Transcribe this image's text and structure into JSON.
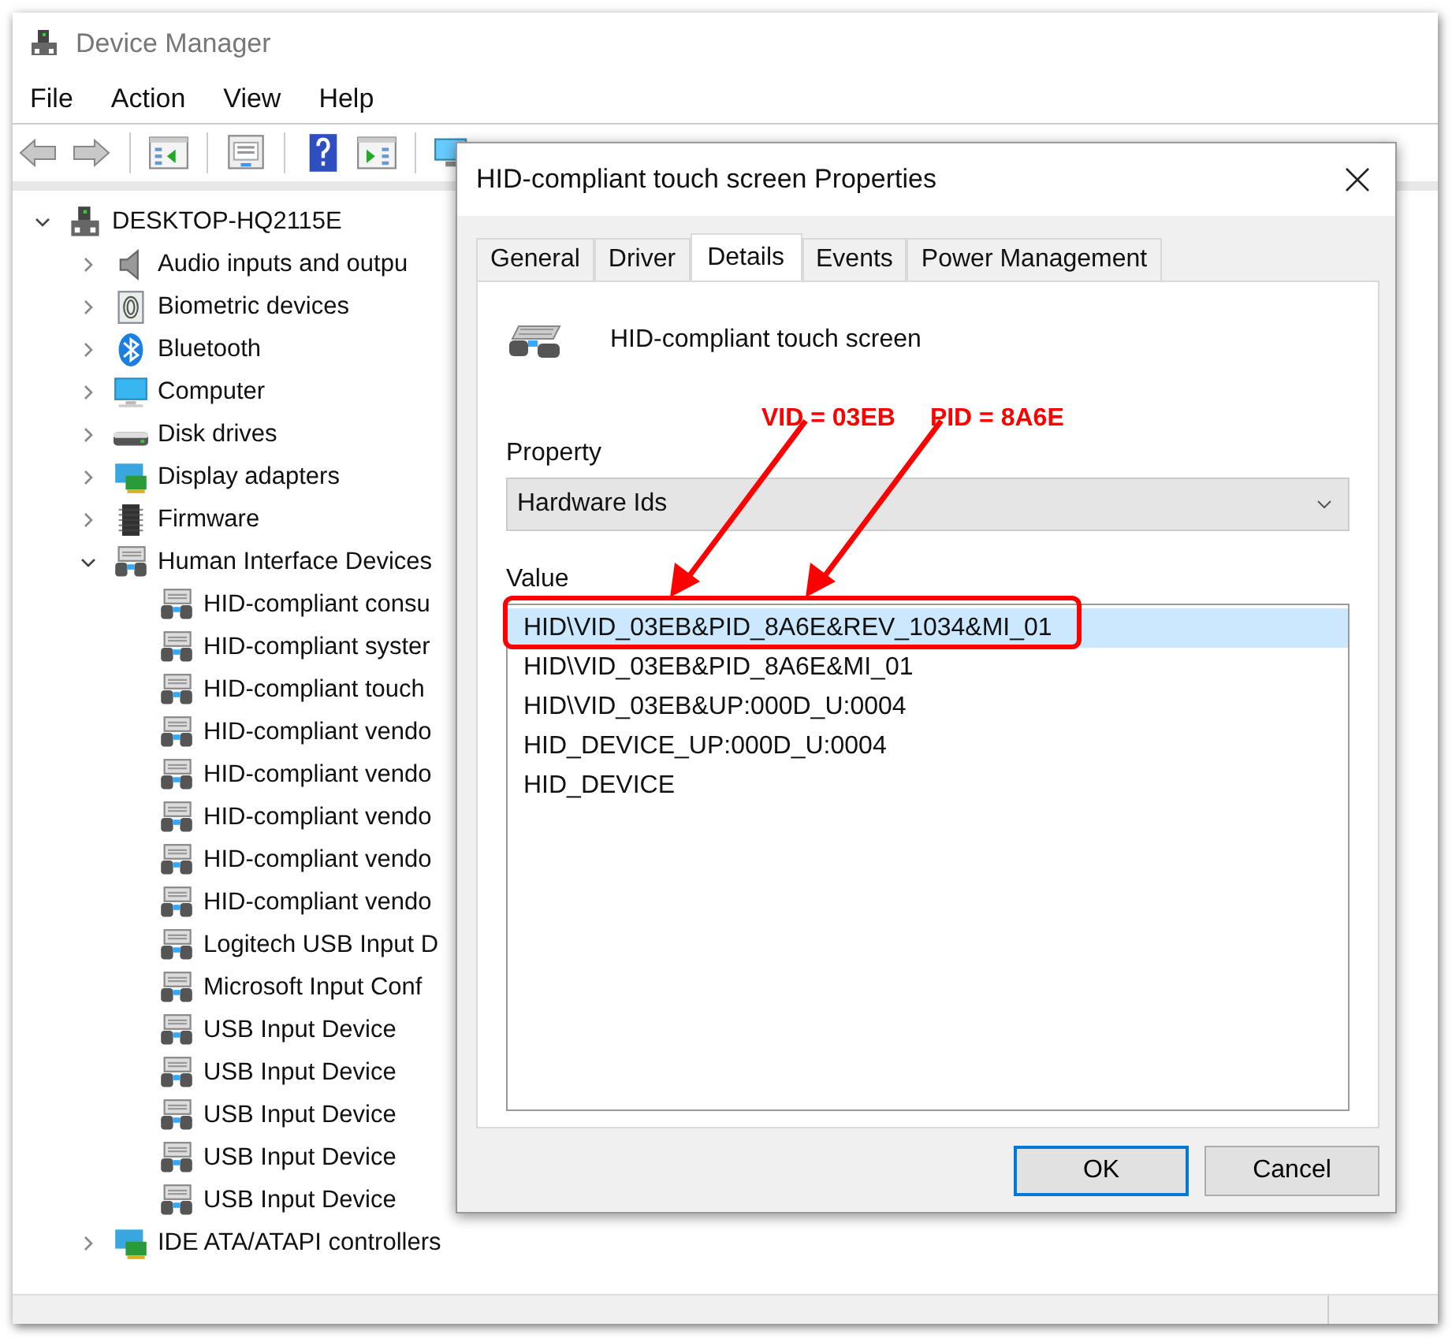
{
  "window": {
    "title": "Device Manager"
  },
  "menu": [
    "File",
    "Action",
    "View",
    "Help"
  ],
  "tree": {
    "label": "DESKTOP-HQ2115E",
    "kind": "computer",
    "expanded": true,
    "children": [
      {
        "label": "Audio inputs and outpu",
        "kind": "speaker",
        "expanded": false
      },
      {
        "label": "Biometric devices",
        "kind": "fingerprint",
        "expanded": false
      },
      {
        "label": "Bluetooth",
        "kind": "bluetooth",
        "expanded": false
      },
      {
        "label": "Computer",
        "kind": "monitor",
        "expanded": false
      },
      {
        "label": "Disk drives",
        "kind": "disk",
        "expanded": false
      },
      {
        "label": "Display adapters",
        "kind": "adapter",
        "expanded": false
      },
      {
        "label": "Firmware",
        "kind": "chip",
        "expanded": false
      },
      {
        "label": "Human Interface Devices",
        "kind": "hid",
        "expanded": true,
        "children": [
          {
            "label": "HID-compliant consu",
            "kind": "hid"
          },
          {
            "label": "HID-compliant syster",
            "kind": "hid"
          },
          {
            "label": "HID-compliant touch",
            "kind": "hid"
          },
          {
            "label": "HID-compliant vendo",
            "kind": "hid"
          },
          {
            "label": "HID-compliant vendo",
            "kind": "hid"
          },
          {
            "label": "HID-compliant vendo",
            "kind": "hid"
          },
          {
            "label": "HID-compliant vendo",
            "kind": "hid"
          },
          {
            "label": "HID-compliant vendo",
            "kind": "hid"
          },
          {
            "label": "Logitech USB Input D",
            "kind": "hid"
          },
          {
            "label": "Microsoft Input Conf",
            "kind": "hid"
          },
          {
            "label": "USB Input Device",
            "kind": "hid"
          },
          {
            "label": "USB Input Device",
            "kind": "hid"
          },
          {
            "label": "USB Input Device",
            "kind": "hid"
          },
          {
            "label": "USB Input Device",
            "kind": "hid"
          },
          {
            "label": "USB Input Device",
            "kind": "hid"
          }
        ]
      },
      {
        "label": "IDE ATA/ATAPI controllers",
        "kind": "adapter",
        "expanded": false
      }
    ]
  },
  "dialog": {
    "title": "HID-compliant touch screen Properties",
    "tabs": [
      {
        "label": "General",
        "selected": false
      },
      {
        "label": "Driver",
        "selected": false
      },
      {
        "label": "Details",
        "selected": true
      },
      {
        "label": "Events",
        "selected": false
      },
      {
        "label": "Power Management",
        "selected": false
      }
    ],
    "device_name": "HID-compliant touch screen",
    "property_label": "Property",
    "property_value": "Hardware Ids",
    "value_label": "Value",
    "values": [
      {
        "text": "HID\\VID_03EB&PID_8A6E&REV_1034&MI_01",
        "selected": true
      },
      {
        "text": "HID\\VID_03EB&PID_8A6E&MI_01",
        "selected": false
      },
      {
        "text": "HID\\VID_03EB&UP:000D_U:0004",
        "selected": false
      },
      {
        "text": "HID_DEVICE_UP:000D_U:0004",
        "selected": false
      },
      {
        "text": "HID_DEVICE",
        "selected": false
      }
    ],
    "annotations": [
      "VID = 03EB",
      "PID = 8A6E"
    ],
    "buttons": [
      {
        "label": "OK",
        "default": true
      },
      {
        "label": "Cancel",
        "default": false
      }
    ]
  }
}
